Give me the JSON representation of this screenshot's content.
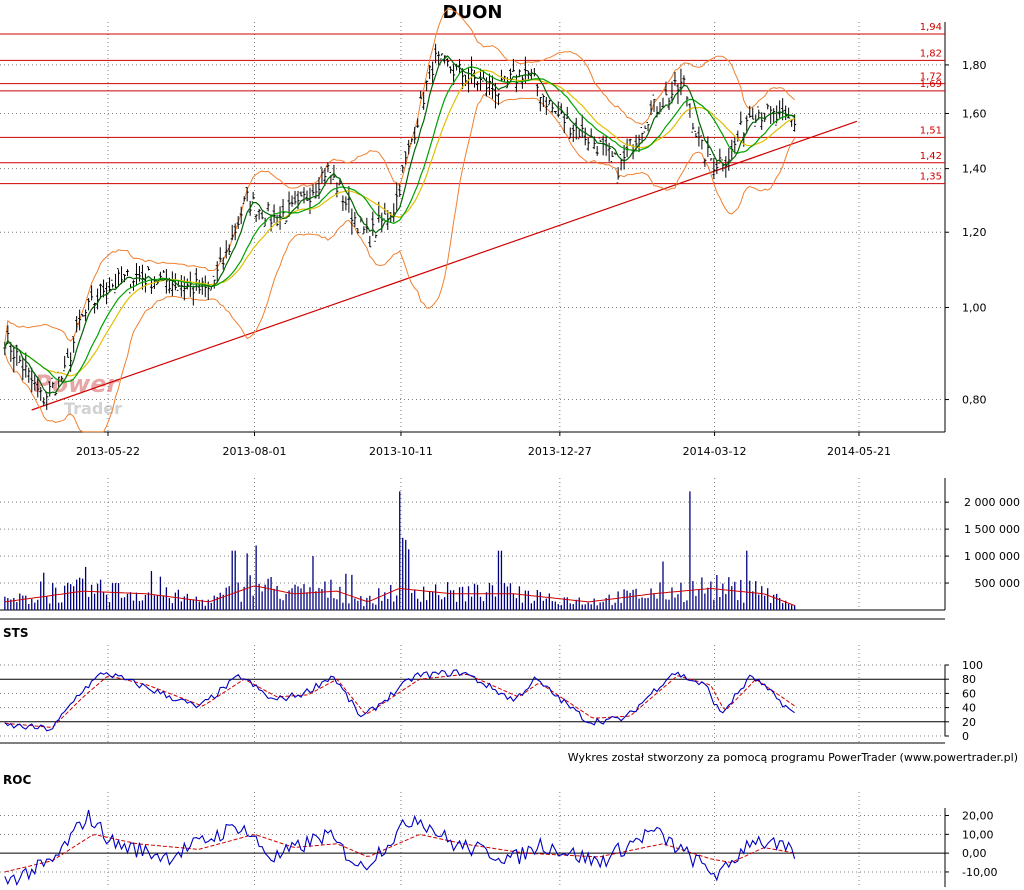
{
  "chart_data": [
    {
      "type": "candlestick",
      "title": "DUON",
      "x_ticks": [
        "2013-05-22",
        "2013-08-01",
        "2013-10-11",
        "2013-12-27",
        "2014-03-12",
        "2014-05-21"
      ],
      "y_scale": "log",
      "y_ticks": [
        "0,80",
        "1,00",
        "1,20",
        "1,40",
        "1,60",
        "1,80"
      ],
      "y_tick_values": [
        0.8,
        1.0,
        1.2,
        1.4,
        1.6,
        1.8
      ],
      "ylim": [
        0.74,
        1.96
      ],
      "horizontal_levels": [
        {
          "label": "1,94",
          "value": 1.94
        },
        {
          "label": "1,82",
          "value": 1.82
        },
        {
          "label": "1,72",
          "value": 1.72
        },
        {
          "label": "1,69",
          "value": 1.69
        },
        {
          "label": "1,51",
          "value": 1.51
        },
        {
          "label": "1,42",
          "value": 1.42
        },
        {
          "label": "1,35",
          "value": 1.35
        }
      ],
      "trendline": {
        "from": [
          "2013-04-15",
          0.78
        ],
        "to": [
          "2014-05-20",
          1.57
        ]
      },
      "close_path": [
        [
          "2013-04-02",
          0.93
        ],
        [
          "2013-04-20",
          0.8
        ],
        [
          "2013-05-01",
          0.85
        ],
        [
          "2013-05-08",
          0.96
        ],
        [
          "2013-05-20",
          1.05
        ],
        [
          "2013-06-05",
          1.08
        ],
        [
          "2013-06-25",
          1.06
        ],
        [
          "2013-07-10",
          1.04
        ],
        [
          "2013-07-18",
          1.13
        ],
        [
          "2013-07-28",
          1.3
        ],
        [
          "2013-08-10",
          1.24
        ],
        [
          "2013-08-22",
          1.27
        ],
        [
          "2013-09-05",
          1.4
        ],
        [
          "2013-09-18",
          1.25
        ],
        [
          "2013-09-25",
          1.18
        ],
        [
          "2013-10-08",
          1.28
        ],
        [
          "2013-10-18",
          1.55
        ],
        [
          "2013-10-27",
          1.82
        ],
        [
          "2013-11-10",
          1.76
        ],
        [
          "2013-11-28",
          1.69
        ],
        [
          "2013-12-10",
          1.78
        ],
        [
          "2013-12-25",
          1.6
        ],
        [
          "2014-01-15",
          1.48
        ],
        [
          "2014-01-25",
          1.4
        ],
        [
          "2014-02-08",
          1.6
        ],
        [
          "2014-02-25",
          1.72
        ],
        [
          "2014-03-05",
          1.47
        ],
        [
          "2014-03-12",
          1.42
        ],
        [
          "2014-03-20",
          1.45
        ],
        [
          "2014-03-30",
          1.62
        ],
        [
          "2014-04-15",
          1.57
        ],
        [
          "2014-04-20",
          1.57
        ]
      ]
    },
    {
      "type": "bar",
      "title": "",
      "y_ticks": [
        "500 000",
        "1 000 000",
        "1 500 000",
        "2 000 000"
      ],
      "y_tick_values": [
        500000,
        1000000,
        1500000,
        2000000
      ],
      "ylim": [
        0,
        2300000
      ],
      "spikes": [
        [
          "2013-04-25",
          500000
        ],
        [
          "2013-05-08",
          600000
        ],
        [
          "2013-05-25",
          500000
        ],
        [
          "2013-07-22",
          1100000
        ],
        [
          "2013-07-28",
          1050000
        ],
        [
          "2013-08-30",
          1000000
        ],
        [
          "2013-10-10",
          2200000
        ],
        [
          "2013-10-13",
          1300000
        ],
        [
          "2013-11-28",
          1100000
        ],
        [
          "2014-02-15",
          900000
        ],
        [
          "2014-02-28",
          1000000
        ],
        [
          "2014-03-28",
          1100000
        ]
      ],
      "volume_mean_path": [
        [
          "2013-04-02",
          150000
        ],
        [
          "2013-05-10",
          350000
        ],
        [
          "2013-06-10",
          300000
        ],
        [
          "2013-07-10",
          150000
        ],
        [
          "2013-08-01",
          450000
        ],
        [
          "2013-08-20",
          300000
        ],
        [
          "2013-09-10",
          350000
        ],
        [
          "2013-09-25",
          150000
        ],
        [
          "2013-10-10",
          400000
        ],
        [
          "2013-11-05",
          300000
        ],
        [
          "2013-12-05",
          300000
        ],
        [
          "2014-01-10",
          150000
        ],
        [
          "2014-02-10",
          300000
        ],
        [
          "2014-03-10",
          400000
        ],
        [
          "2014-04-05",
          300000
        ],
        [
          "2014-04-20",
          80000
        ]
      ]
    },
    {
      "type": "line",
      "title": "STS",
      "y_ticks": [
        "0",
        "20",
        "40",
        "60",
        "80",
        "100"
      ],
      "ylim": [
        0,
        100
      ],
      "levels": [
        20,
        80
      ],
      "k_path": [
        [
          "2013-04-02",
          15
        ],
        [
          "2013-04-25",
          10
        ],
        [
          "2013-05-08",
          60
        ],
        [
          "2013-05-20",
          90
        ],
        [
          "2013-06-08",
          70
        ],
        [
          "2013-07-05",
          40
        ],
        [
          "2013-07-25",
          85
        ],
        [
          "2013-08-10",
          50
        ],
        [
          "2013-08-25",
          60
        ],
        [
          "2013-09-08",
          85
        ],
        [
          "2013-09-22",
          25
        ],
        [
          "2013-10-18",
          85
        ],
        [
          "2013-11-10",
          90
        ],
        [
          "2013-12-05",
          50
        ],
        [
          "2013-12-15",
          80
        ],
        [
          "2014-01-10",
          20
        ],
        [
          "2014-01-28",
          25
        ],
        [
          "2014-02-20",
          90
        ],
        [
          "2014-03-08",
          70
        ],
        [
          "2014-03-15",
          30
        ],
        [
          "2014-03-30",
          85
        ],
        [
          "2014-04-20",
          30
        ]
      ],
      "d_path": [
        [
          "2013-04-02",
          18
        ],
        [
          "2013-04-25",
          12
        ],
        [
          "2013-05-10",
          55
        ],
        [
          "2013-05-22",
          85
        ],
        [
          "2013-06-10",
          72
        ],
        [
          "2013-07-07",
          42
        ],
        [
          "2013-07-27",
          80
        ],
        [
          "2013-08-12",
          55
        ],
        [
          "2013-08-27",
          58
        ],
        [
          "2013-09-10",
          80
        ],
        [
          "2013-09-24",
          30
        ],
        [
          "2013-10-20",
          80
        ],
        [
          "2013-11-12",
          87
        ],
        [
          "2013-12-07",
          55
        ],
        [
          "2013-12-17",
          75
        ],
        [
          "2014-01-12",
          25
        ],
        [
          "2014-01-30",
          28
        ],
        [
          "2014-02-22",
          85
        ],
        [
          "2014-03-10",
          72
        ],
        [
          "2014-03-17",
          35
        ],
        [
          "2014-04-01",
          80
        ],
        [
          "2014-04-20",
          42
        ]
      ]
    },
    {
      "type": "line",
      "title": "ROC",
      "y_ticks": [
        "-10,00",
        "0,00",
        "10,00",
        "20,00"
      ],
      "ylim": [
        -18,
        24
      ],
      "levels": [
        0
      ],
      "roc_path": [
        [
          "2013-04-02",
          -15
        ],
        [
          "2013-04-25",
          -5
        ],
        [
          "2013-05-12",
          20
        ],
        [
          "2013-05-25",
          5
        ],
        [
          "2013-06-20",
          -2
        ],
        [
          "2013-07-25",
          15
        ],
        [
          "2013-08-10",
          -3
        ],
        [
          "2013-09-05",
          10
        ],
        [
          "2013-09-22",
          -8
        ],
        [
          "2013-10-18",
          20
        ],
        [
          "2013-11-05",
          5
        ],
        [
          "2013-12-05",
          -3
        ],
        [
          "2013-12-18",
          5
        ],
        [
          "2014-01-15",
          -5
        ],
        [
          "2014-02-10",
          12
        ],
        [
          "2014-03-08",
          -8
        ],
        [
          "2014-03-15",
          -12
        ],
        [
          "2014-03-30",
          8
        ],
        [
          "2014-04-20",
          0
        ]
      ],
      "signal_path": [
        [
          "2013-04-02",
          -10
        ],
        [
          "2013-04-25",
          -4
        ],
        [
          "2013-05-15",
          10
        ],
        [
          "2013-06-05",
          5
        ],
        [
          "2013-07-05",
          2
        ],
        [
          "2013-08-01",
          10
        ],
        [
          "2013-08-20",
          3
        ],
        [
          "2013-09-10",
          5
        ],
        [
          "2013-09-25",
          -2
        ],
        [
          "2013-10-20",
          10
        ],
        [
          "2013-11-10",
          5
        ],
        [
          "2013-12-10",
          0
        ],
        [
          "2014-01-15",
          -2
        ],
        [
          "2014-02-15",
          5
        ],
        [
          "2014-03-10",
          -3
        ],
        [
          "2014-03-20",
          -5
        ],
        [
          "2014-04-05",
          3
        ],
        [
          "2014-04-20",
          0
        ]
      ]
    }
  ],
  "watermark": {
    "line1": "Power",
    "line2": "Trader"
  },
  "credit": "Wykres został stworzony za pomocą programu PowerTrader (www.powertrader.pl)",
  "colors": {
    "price_line": "#006400",
    "ma_fast": "#00a000",
    "ma_slow": "#e0c000",
    "bands": "#f08030",
    "levels": "#d00000",
    "volume": "#000080",
    "osc_main": "#0000c0",
    "osc_signal": "#d00000",
    "grid": "#808080"
  }
}
